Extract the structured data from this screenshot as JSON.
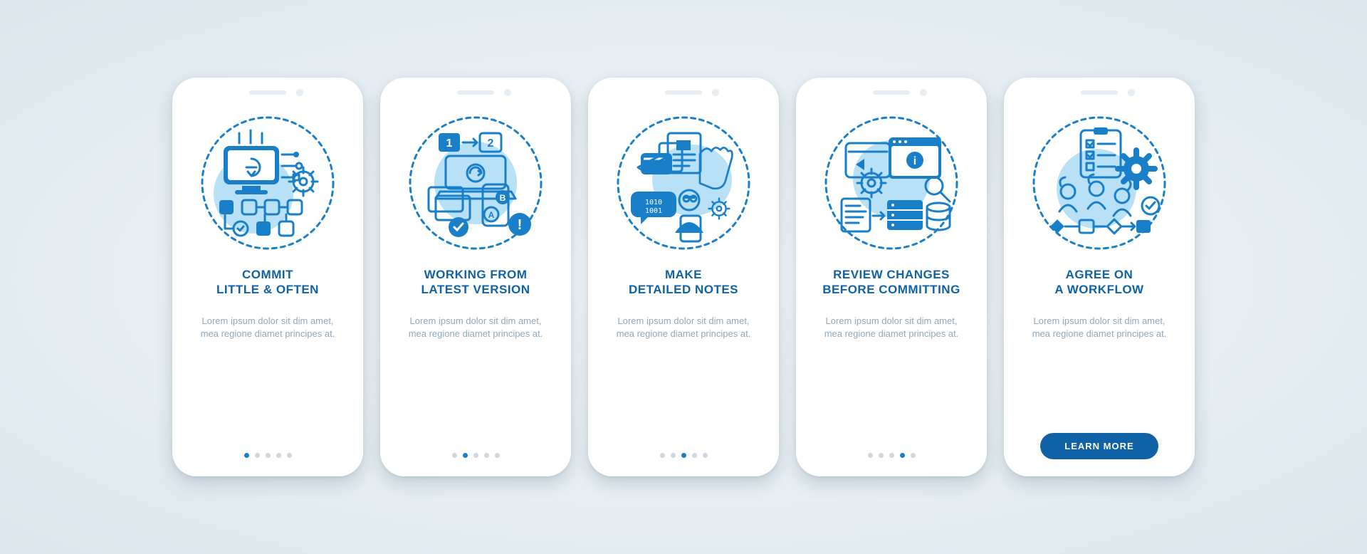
{
  "colors": {
    "primary": "#0f62a6",
    "accent": "#1a7fc9",
    "light": "#b8e0f6",
    "muted": "#8fa8bb"
  },
  "cards": [
    {
      "title": "COMMIT\nLITTLE & OFTEN",
      "body": "Lorem ipsum dolor sit dim amet, mea regione diamet principes at.",
      "active_dot": 0,
      "icon": "commit-often"
    },
    {
      "title": "WORKING FROM\nLATEST VERSION",
      "body": "Lorem ipsum dolor sit dim amet, mea regione diamet principes at.",
      "active_dot": 1,
      "icon": "latest-version"
    },
    {
      "title": "MAKE\nDETAILED NOTES",
      "body": "Lorem ipsum dolor sit dim amet, mea regione diamet principes at.",
      "active_dot": 2,
      "icon": "detailed-notes"
    },
    {
      "title": "REVIEW CHANGES\nBEFORE COMMITTING",
      "body": "Lorem ipsum dolor sit dim amet, mea regione diamet principes at.",
      "active_dot": 3,
      "icon": "review-changes"
    },
    {
      "title": "AGREE ON\nA WORKFLOW",
      "body": "Lorem ipsum dolor sit dim amet, mea regione diamet principes at.",
      "active_dot": 4,
      "icon": "agree-workflow",
      "cta": "LEARN MORE"
    }
  ],
  "dot_count": 5
}
